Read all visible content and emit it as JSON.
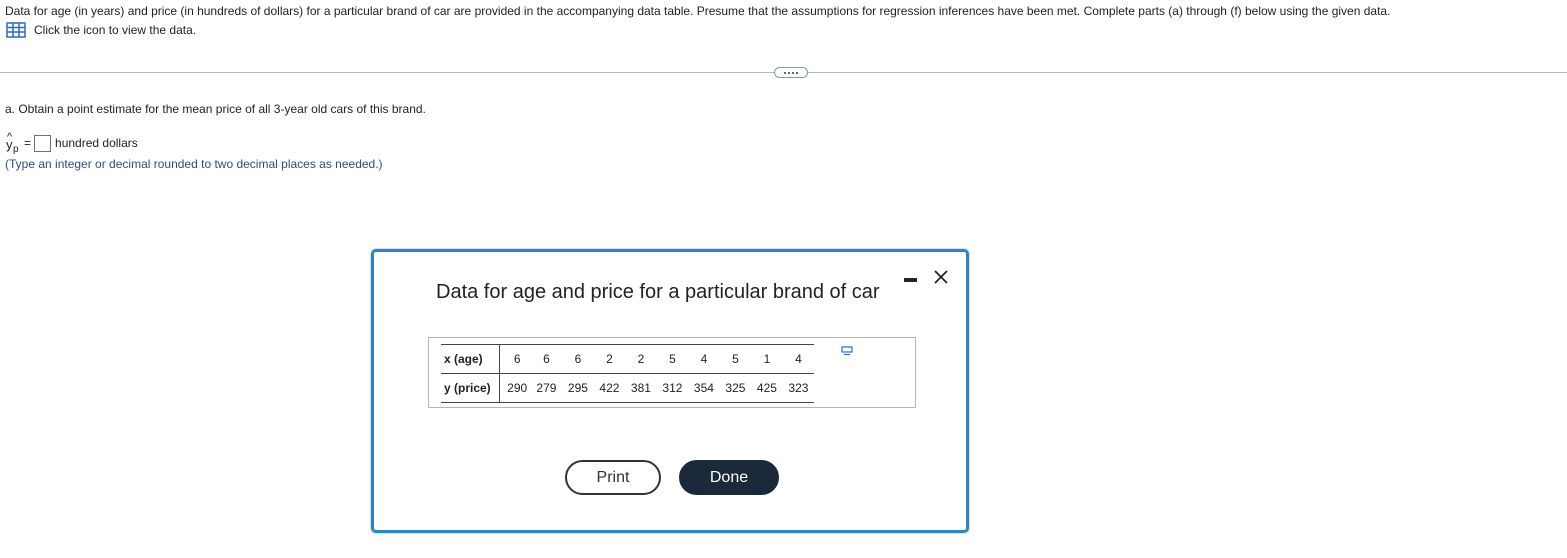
{
  "intro_text": "Data for age (in years) and price (in hundreds of dollars) for a particular brand of car are provided in the accompanying data table. Presume that the assumptions for regression inferences have been met. Complete parts (a) through (f) below using the given data.",
  "data_link_label": "Click the icon to view the data.",
  "part_a": {
    "prompt": "a. Obtain a point estimate for the mean price of all 3-year old cars of this brand.",
    "symbol": "y",
    "hat": "^",
    "subscript": "p",
    "equals": "=",
    "answer_value": "",
    "unit": "hundred dollars",
    "hint": "(Type an integer or decimal rounded to two decimal places as needed.)"
  },
  "dialog": {
    "title": "Data for age and price for a particular brand of car",
    "table": {
      "row_x_label": "x (age)",
      "row_y_label": "y (price)",
      "x_values": [
        "6",
        "6",
        "6",
        "2",
        "2",
        "5",
        "4",
        "5",
        "1",
        "4"
      ],
      "y_values": [
        "290",
        "279",
        "295",
        "422",
        "381",
        "312",
        "354",
        "325",
        "425",
        "323"
      ]
    },
    "print_label": "Print",
    "done_label": "Done"
  },
  "colors": {
    "dialog_border": "#2e86c1",
    "done_button_bg": "#1b2a3a",
    "hint_text": "#2d4f7f",
    "icon_blue": "#2a6eb6"
  }
}
